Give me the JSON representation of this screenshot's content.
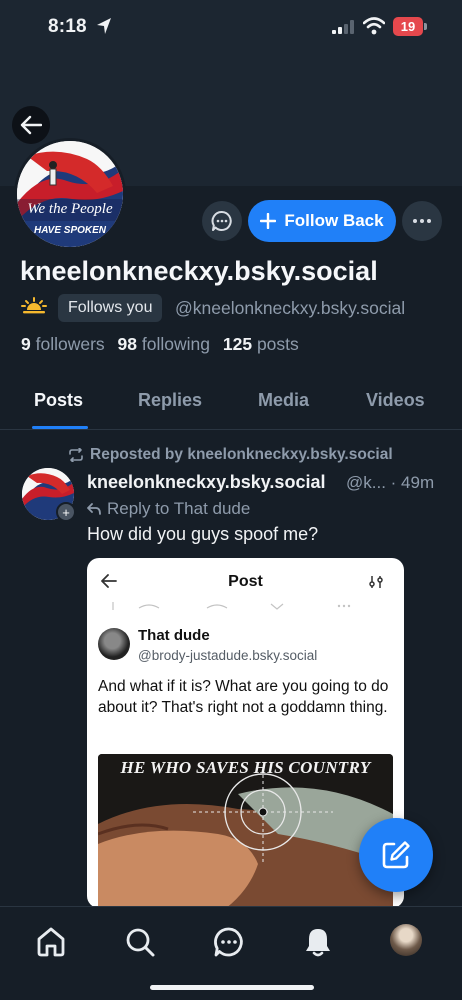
{
  "status_bar": {
    "time": "8:18",
    "battery": "19"
  },
  "profile": {
    "avatar_text_line1": "We the People",
    "avatar_text_line2": "HAVE SPOKEN",
    "display_name": "kneelonkneckxy.bsky.social",
    "follows_you": "Follows you",
    "handle": "@kneelonkneckxy.bsky.social",
    "followers_count": "9",
    "followers_label": "followers",
    "following_count": "98",
    "following_label": "following",
    "posts_count": "125",
    "posts_label": "posts",
    "follow_button": "Follow Back"
  },
  "tabs": [
    {
      "label": "Posts",
      "active": true
    },
    {
      "label": "Replies",
      "active": false
    },
    {
      "label": "Media",
      "active": false
    },
    {
      "label": "Videos",
      "active": false
    }
  ],
  "feed": {
    "repost_label": "Reposted by kneelonkneckxy.bsky.social",
    "post": {
      "author": "kneelonkneckxy.bsky.social",
      "handle_time": "@k... · 49m",
      "reply_to": "Reply to That dude",
      "text": "How did you guys spoof me?",
      "embed": {
        "title": "Post",
        "author_name": "That dude",
        "author_handle": "@brody-justadude.bsky.social",
        "body": "And what if it is? What are you going to do about it? That's right not a goddamn thing.",
        "image_caption": "HE WHO SAVES HIS COUNTRY"
      }
    }
  },
  "colors": {
    "accent": "#2080f8",
    "background": "#161e27",
    "banner": "#1c2631"
  },
  "icons": {
    "back": "arrow-left-icon",
    "message": "chat-bubble-icon",
    "more": "ellipsis-icon",
    "compose": "compose-icon",
    "nav": [
      "home-icon",
      "search-icon",
      "chat-icon",
      "bell-icon",
      "profile-avatar"
    ]
  }
}
